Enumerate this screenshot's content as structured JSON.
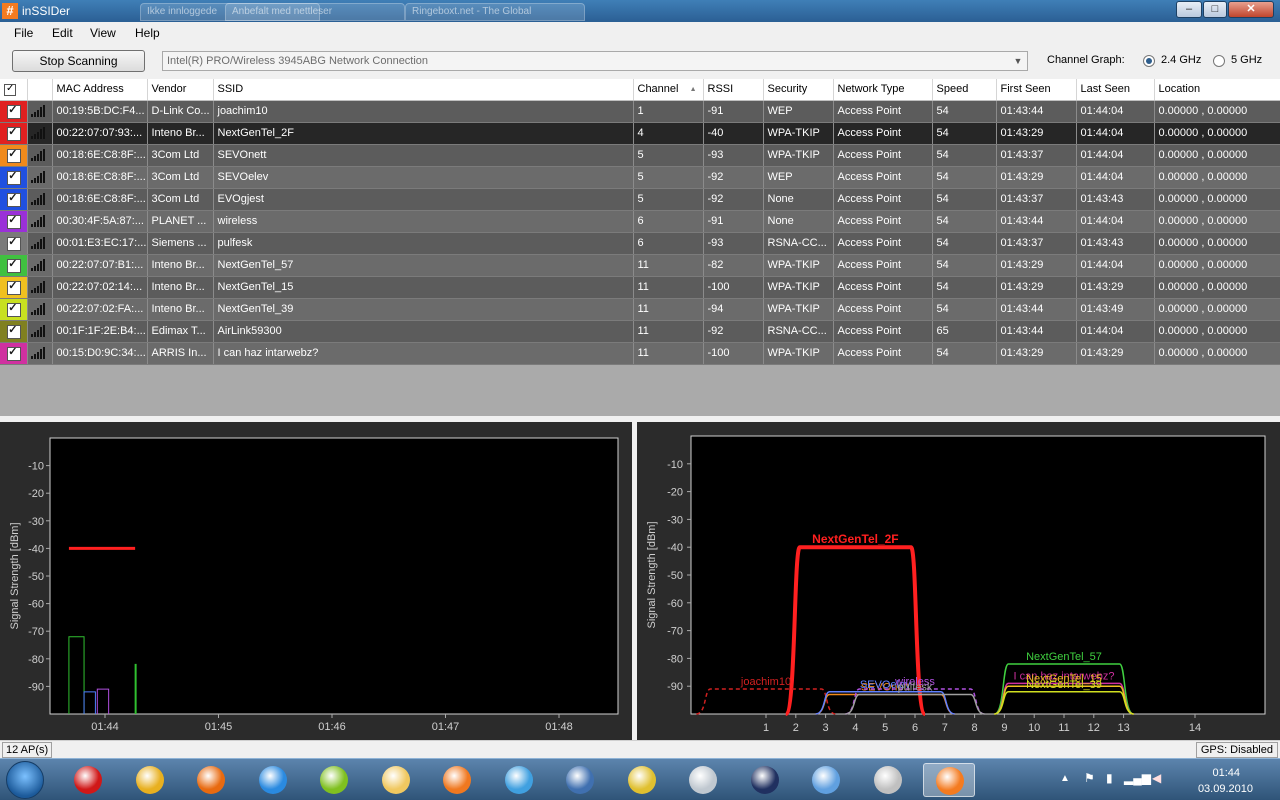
{
  "window": {
    "title": "inSSIDer",
    "icon": "#"
  },
  "browser_tabs": [
    "Ikke innloggede",
    "Anbefalt med nettleser",
    "Ringeboxt.net - The Global"
  ],
  "window_controls": {
    "minimize": "–",
    "maximize": "□",
    "close": "✕"
  },
  "menu": [
    "File",
    "Edit",
    "View",
    "Help"
  ],
  "toolbar": {
    "scan_button": "Stop Scanning",
    "adapter": "Intel(R) PRO/Wireless 3945ABG Network Connection",
    "channel_graph_label": "Channel Graph:",
    "band_24": "2.4 GHz",
    "band_5": "5 GHz",
    "selected_band": "2.4 GHz"
  },
  "grid": {
    "columns": [
      "",
      "",
      "MAC Address",
      "Vendor",
      "SSID",
      "Channel",
      "RSSI",
      "Security",
      "Network Type",
      "Speed",
      "First Seen",
      "Last Seen",
      "Location"
    ],
    "sort_column": "Channel",
    "rows": [
      {
        "color": "#e02020",
        "bars": 3,
        "mac": "00:19:5B:DC:F4...",
        "vendor": "D-Link Co...",
        "ssid": "joachim10",
        "channel": "1",
        "rssi": "-91",
        "security": "WEP",
        "type": "Access Point",
        "speed": "54",
        "first": "01:43:44",
        "last": "01:44:04",
        "location": "0.00000 , 0.00000"
      },
      {
        "color": "#e02020",
        "bars": 5,
        "mac": "00:22:07:07:93:...",
        "vendor": "Inteno Br...",
        "ssid": "NextGenTel_2F",
        "channel": "4",
        "rssi": "-40",
        "security": "WPA-TKIP",
        "type": "Access Point",
        "speed": "54",
        "first": "01:43:29",
        "last": "01:44:04",
        "location": "0.00000 , 0.00000"
      },
      {
        "color": "#f08a1c",
        "bars": 3,
        "mac": "00:18:6E:C8:8F:...",
        "vendor": "3Com Ltd",
        "ssid": "SEVOnett",
        "channel": "5",
        "rssi": "-93",
        "security": "WPA-TKIP",
        "type": "Access Point",
        "speed": "54",
        "first": "01:43:37",
        "last": "01:44:04",
        "location": "0.00000 , 0.00000"
      },
      {
        "color": "#2050e0",
        "bars": 3,
        "mac": "00:18:6E:C8:8F:...",
        "vendor": "3Com Ltd",
        "ssid": "SEVOelev",
        "channel": "5",
        "rssi": "-92",
        "security": "WEP",
        "type": "Access Point",
        "speed": "54",
        "first": "01:43:29",
        "last": "01:44:04",
        "location": "0.00000 , 0.00000"
      },
      {
        "color": "#2050e0",
        "bars": 3,
        "mac": "00:18:6E:C8:8F:...",
        "vendor": "3Com Ltd",
        "ssid": "EVOgjest",
        "channel": "5",
        "rssi": "-92",
        "security": "None",
        "type": "Access Point",
        "speed": "54",
        "first": "01:43:37",
        "last": "01:43:43",
        "location": "0.00000 , 0.00000"
      },
      {
        "color": "#9a30d8",
        "bars": 3,
        "mac": "00:30:4F:5A:87:...",
        "vendor": "PLANET ...",
        "ssid": "wireless",
        "channel": "6",
        "rssi": "-91",
        "security": "None",
        "type": "Access Point",
        "speed": "54",
        "first": "01:43:44",
        "last": "01:44:04",
        "location": "0.00000 , 0.00000"
      },
      {
        "color": "#7a7a7a",
        "bars": 3,
        "mac": "00:01:E3:EC:17:...",
        "vendor": "Siemens ...",
        "ssid": "pulfesk",
        "channel": "6",
        "rssi": "-93",
        "security": "RSNA-CC...",
        "type": "Access Point",
        "speed": "54",
        "first": "01:43:37",
        "last": "01:43:43",
        "location": "0.00000 , 0.00000"
      },
      {
        "color": "#40c040",
        "bars": 3,
        "mac": "00:22:07:07:B1:...",
        "vendor": "Inteno Br...",
        "ssid": "NextGenTel_57",
        "channel": "11",
        "rssi": "-82",
        "security": "WPA-TKIP",
        "type": "Access Point",
        "speed": "54",
        "first": "01:43:29",
        "last": "01:44:04",
        "location": "0.00000 , 0.00000"
      },
      {
        "color": "#f0c020",
        "bars": 3,
        "mac": "00:22:07:02:14:...",
        "vendor": "Inteno Br...",
        "ssid": "NextGenTel_15",
        "channel": "11",
        "rssi": "-100",
        "security": "WPA-TKIP",
        "type": "Access Point",
        "speed": "54",
        "first": "01:43:29",
        "last": "01:43:29",
        "location": "0.00000 , 0.00000"
      },
      {
        "color": "#c8e020",
        "bars": 3,
        "mac": "00:22:07:02:FA:...",
        "vendor": "Inteno Br...",
        "ssid": "NextGenTel_39",
        "channel": "11",
        "rssi": "-94",
        "security": "WPA-TKIP",
        "type": "Access Point",
        "speed": "54",
        "first": "01:43:44",
        "last": "01:43:49",
        "location": "0.00000 , 0.00000"
      },
      {
        "color": "#808020",
        "bars": 3,
        "mac": "00:1F:1F:2E:B4:...",
        "vendor": "Edimax T...",
        "ssid": "AirLink59300",
        "channel": "11",
        "rssi": "-92",
        "security": "RSNA-CC...",
        "type": "Access Point",
        "speed": "65",
        "first": "01:43:44",
        "last": "01:44:04",
        "location": "0.00000 , 0.00000"
      },
      {
        "color": "#d030a0",
        "bars": 3,
        "mac": "00:15:D0:9C:34:...",
        "vendor": "ARRIS In...",
        "ssid": "I can haz intarwebz?",
        "channel": "11",
        "rssi": "-100",
        "security": "WPA-TKIP",
        "type": "Access Point",
        "speed": "54",
        "first": "01:43:29",
        "last": "01:43:29",
        "location": "0.00000 , 0.00000"
      }
    ],
    "selected_row": 1
  },
  "chart_data": [
    {
      "type": "line",
      "ylabel": "Signal Strength [dBm]",
      "ylim": [
        -100,
        0
      ],
      "yticks": [
        -10,
        -20,
        -30,
        -40,
        -50,
        -60,
        -70,
        -80,
        -90
      ],
      "xticks": [
        "01:44",
        "01:45",
        "01:46",
        "01:47",
        "01:48"
      ],
      "series": [
        {
          "color": "#ff2020",
          "start": "01:43:29",
          "end": "01:44:04",
          "value": -40
        },
        {
          "color": "#30c030",
          "start": "01:43:29",
          "end": "01:43:37",
          "value": -72
        },
        {
          "color": "#30c030",
          "start": "01:44:04",
          "end": "01:44:04",
          "value": -82
        },
        {
          "color": "#5080ff",
          "start": "01:43:37",
          "end": "01:43:43",
          "value": -92
        },
        {
          "color": "#b050e0",
          "start": "01:43:44",
          "end": "01:43:50",
          "value": -91
        }
      ]
    },
    {
      "type": "area",
      "ylabel": "Signal Strength [dBm]",
      "ylim": [
        -100,
        0
      ],
      "yticks": [
        -10,
        -20,
        -30,
        -40,
        -50,
        -60,
        -70,
        -80,
        -90
      ],
      "xticks": [
        "1",
        "2",
        "3",
        "4",
        "5",
        "6",
        "7",
        "8",
        "9",
        "10",
        "11",
        "12",
        "13",
        "14"
      ],
      "networks": [
        {
          "ssid": "NextGenTel_2F",
          "channel": 4,
          "rssi": -40,
          "color": "#ff2020",
          "width": 4,
          "dashed": false
        },
        {
          "ssid": "joachim10",
          "channel": 1,
          "rssi": -91,
          "color": "#d02020",
          "width": 1.5,
          "dashed": true
        },
        {
          "ssid": "SEVOnett",
          "channel": 5,
          "rssi": -93,
          "color": "#f08a1c",
          "width": 1.5,
          "dashed": false
        },
        {
          "ssid": "SEVOelev",
          "channel": 5,
          "rssi": -92,
          "color": "#6080ff",
          "width": 1.5,
          "dashed": false
        },
        {
          "ssid": "wireless",
          "channel": 6,
          "rssi": -91,
          "color": "#b050e0",
          "width": 1.5,
          "dashed": true
        },
        {
          "ssid": "pulfesk",
          "channel": 6,
          "rssi": -93,
          "color": "#a0a0a0",
          "width": 1.5,
          "dashed": false
        },
        {
          "ssid": "NextGenTel_57",
          "channel": 11,
          "rssi": -82,
          "color": "#40d040",
          "width": 1.5,
          "dashed": false
        },
        {
          "ssid": "I can haz intarwebz?",
          "channel": 11,
          "rssi": -89,
          "color": "#d030a0",
          "width": 1.5,
          "dashed": false
        },
        {
          "ssid": "NextGenTel_15",
          "channel": 11,
          "rssi": -90,
          "color": "#f0c020",
          "width": 1.5,
          "dashed": false
        },
        {
          "ssid": "NextGenTel_39",
          "channel": 11,
          "rssi": -92,
          "color": "#d0e020",
          "width": 1.5,
          "dashed": false
        }
      ]
    }
  ],
  "status": {
    "ap_count": "12 AP(s)",
    "gps": "GPS: Disabled"
  },
  "taskbar": {
    "apps": [
      {
        "name": "opera-icon",
        "color": "#d01818"
      },
      {
        "name": "chrome-icon",
        "color": "#e8b020"
      },
      {
        "name": "firefox-icon",
        "color": "#e86a10"
      },
      {
        "name": "ie-icon",
        "color": "#2a8ae0"
      },
      {
        "name": "spotify-icon",
        "color": "#80c020"
      },
      {
        "name": "explorer-icon",
        "color": "#f0c860"
      },
      {
        "name": "media-player-icon",
        "color": "#f07820"
      },
      {
        "name": "messenger-icon",
        "color": "#40a0e0"
      },
      {
        "name": "outlook-icon",
        "color": "#4070b0"
      },
      {
        "name": "keepass-icon",
        "color": "#e0c030"
      },
      {
        "name": "calculator-icon",
        "color": "#c0c8d0"
      },
      {
        "name": "app-2-icon",
        "color": "#203060"
      },
      {
        "name": "itunes-icon",
        "color": "#60a0e0"
      },
      {
        "name": "sc-icon",
        "color": "#c0c0c0"
      },
      {
        "name": "inssider-icon",
        "color": "#f47b20"
      }
    ],
    "active_app": "inssider-icon",
    "time": "01:44",
    "date": "03.09.2010"
  }
}
